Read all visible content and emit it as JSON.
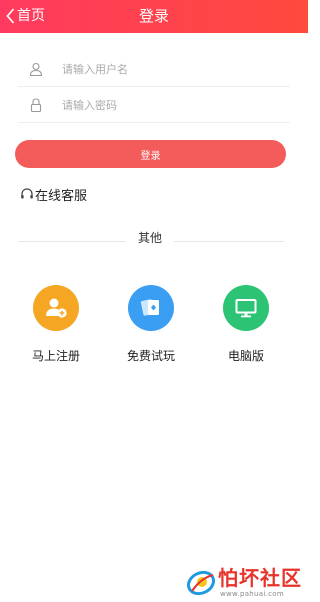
{
  "header": {
    "back_label": "首页",
    "title": "登录"
  },
  "form": {
    "username_placeholder": "请输入用户名",
    "password_placeholder": "请输入密码",
    "login_label": "登录"
  },
  "support_label": "在线客服",
  "divider_label": "其他",
  "options": [
    {
      "label": "马上注册",
      "icon": "add-user-icon",
      "color": "#f5a623"
    },
    {
      "label": "免费试玩",
      "icon": "playing-cards-icon",
      "color": "#3a9ff2"
    },
    {
      "label": "电脑版",
      "icon": "monitor-icon",
      "color": "#2cc374"
    }
  ],
  "watermark": {
    "text": "怕坏社区",
    "url": "www.pahuai.com"
  }
}
